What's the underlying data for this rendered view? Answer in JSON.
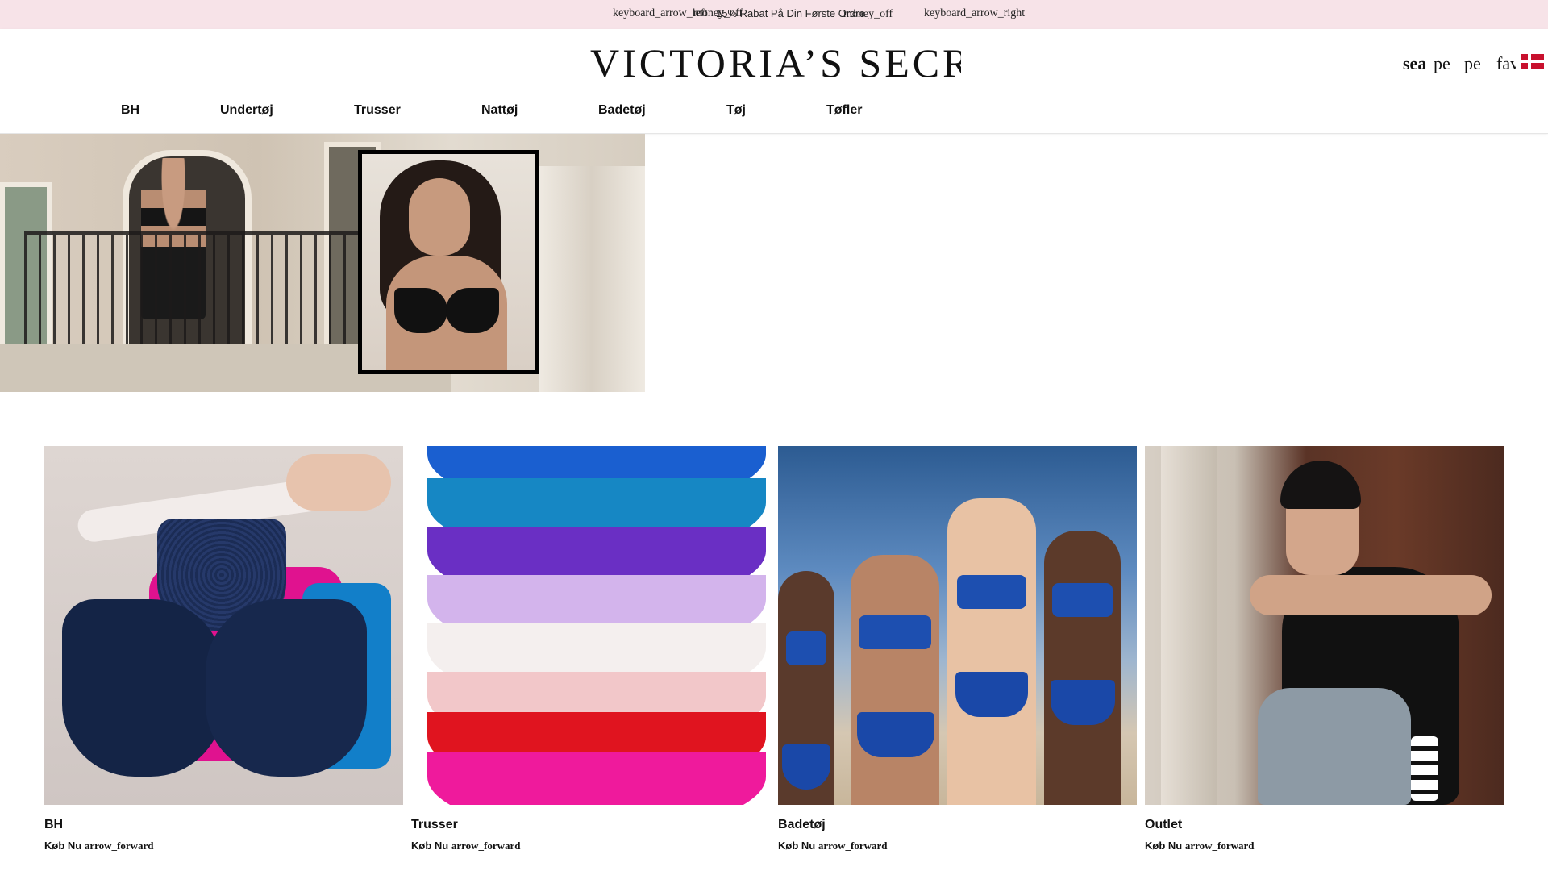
{
  "promo": {
    "left_arrow_text": "keyboard_arrow_left",
    "icon_left_text": "money_off",
    "message": "15% Rabat På Din Første Ordre",
    "icon_right_text": "money_off",
    "right_arrow_text": "keyboard_arrow_right"
  },
  "header": {
    "logo": "VICTORIA’S SECRET",
    "utility": {
      "search": "sea",
      "account_1": "pe",
      "account_2": "pe",
      "favorites": "fav"
    },
    "flag": "denmark-flag-icon"
  },
  "nav": {
    "items": [
      {
        "label": "BH"
      },
      {
        "label": "Undertøj"
      },
      {
        "label": "Trusser"
      },
      {
        "label": "Nattøj"
      },
      {
        "label": "Badetøj"
      },
      {
        "label": "Tøj"
      },
      {
        "label": "Tøfler"
      }
    ]
  },
  "categories": [
    {
      "title": "BH",
      "cta": "Køb Nu",
      "cta_icon": "arrow_forward"
    },
    {
      "title": "Trusser",
      "cta": "Køb Nu",
      "cta_icon": "arrow_forward"
    },
    {
      "title": "Badetøj",
      "cta": "Køb Nu",
      "cta_icon": "arrow_forward"
    },
    {
      "title": "Outlet",
      "cta": "Køb Nu",
      "cta_icon": "arrow_forward"
    }
  ],
  "colors": {
    "promo_bg": "#f7e3e8",
    "text": "#111111",
    "flag_red": "#c8102e"
  }
}
